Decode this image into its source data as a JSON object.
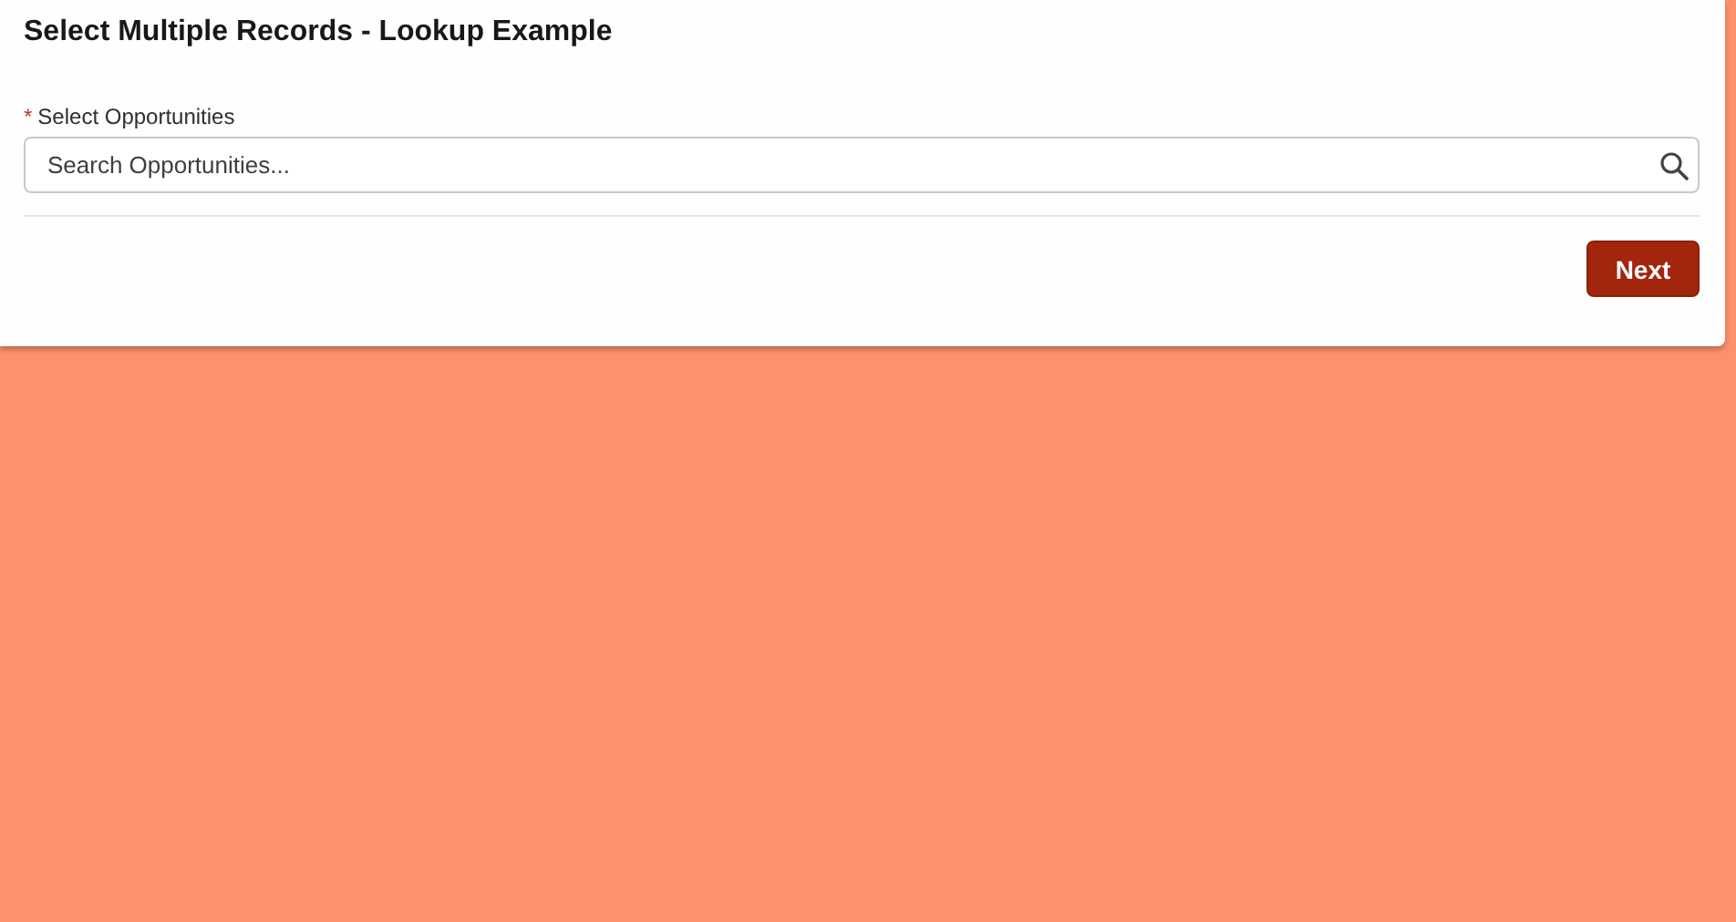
{
  "card": {
    "title": "Select Multiple Records - Lookup Example"
  },
  "field": {
    "required_mark": "*",
    "label": "Select Opportunities",
    "placeholder": "Search Opportunities..."
  },
  "buttons": [
    {
      "label": "Next"
    }
  ]
}
